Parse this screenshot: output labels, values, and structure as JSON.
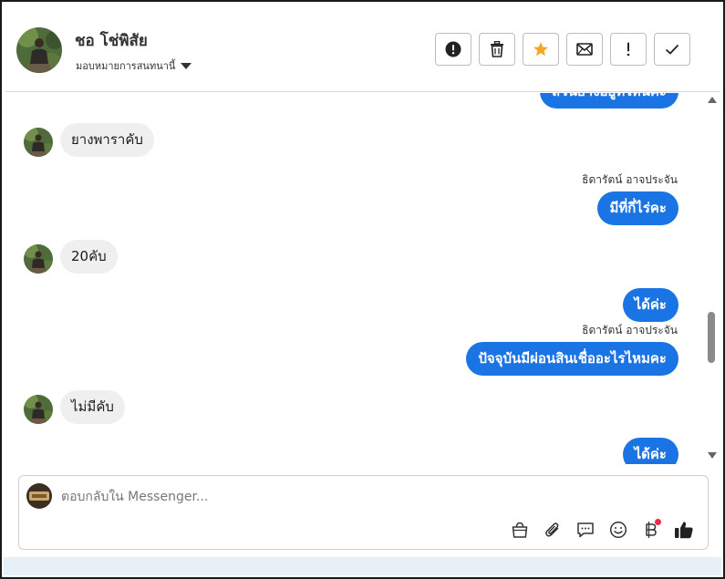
{
  "header": {
    "contact_name": "ชอ โช่พิสัย",
    "assign_label": "มอบหมายการสนทนานี้",
    "actions": [
      {
        "name": "report-button",
        "icon": "exclamation-circle-icon"
      },
      {
        "name": "delete-button",
        "icon": "trash-icon"
      },
      {
        "name": "star-button",
        "icon": "star-icon"
      },
      {
        "name": "mark-unread-button",
        "icon": "envelope-icon"
      },
      {
        "name": "follow-up-button",
        "icon": "exclamation-icon"
      },
      {
        "name": "mark-done-button",
        "icon": "check-icon"
      }
    ]
  },
  "messages": {
    "m0": {
      "text": "สวนยางอยู่ที่ไหนคะ"
    },
    "m1": {
      "text": "ยางพาราคับ"
    },
    "m2": {
      "sender": "ธิดารัตน์ อาจประจัน",
      "text": "มีที่กี่ไร่คะ"
    },
    "m3": {
      "text": "20คับ"
    },
    "m4": {
      "text": "ได้ค่ะ"
    },
    "m5": {
      "sender": "ธิดารัตน์ อาจประจัน",
      "text": "ปัจจุบันมีผ่อนสินเชื่ออะไรไหมคะ"
    },
    "m6": {
      "text": "ไม่มีคับ"
    },
    "m7": {
      "text": "ได้ค่ะ"
    }
  },
  "composer": {
    "placeholder": "ตอบกลับใน Messenger...",
    "tools": [
      "bag-icon",
      "paperclip-icon",
      "chat-bubble-icon",
      "smiley-icon",
      "baht-icon",
      "thumbs-up-icon"
    ]
  },
  "colors": {
    "outgoing_bubble": "#1b74e4",
    "incoming_bubble": "#efefef",
    "star": "#f5a623",
    "notification_dot": "#f0284a"
  }
}
